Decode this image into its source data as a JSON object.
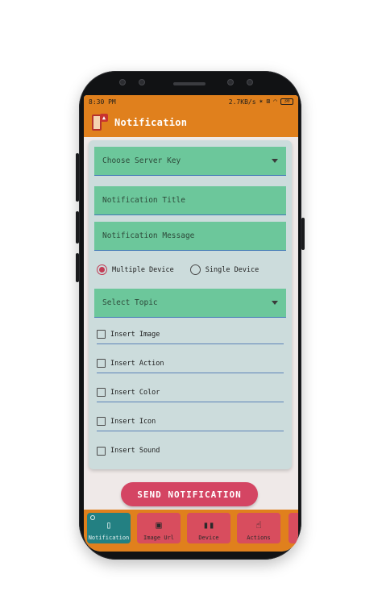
{
  "status_bar": {
    "time": "8:30 PM",
    "speed": "2.7KB/s",
    "battery": "30"
  },
  "app_bar": {
    "title": "Notification"
  },
  "form": {
    "server_key_placeholder": "Choose Server Key",
    "title_placeholder": "Notification Title",
    "message_placeholder": "Notification Message",
    "radio_options": [
      {
        "label": "Multiple Device",
        "selected": true
      },
      {
        "label": "Single Device",
        "selected": false
      }
    ],
    "topic_placeholder": "Select Topic",
    "checkboxes": [
      {
        "label": "Insert Image",
        "checked": false
      },
      {
        "label": "Insert Action",
        "checked": false
      },
      {
        "label": "Insert Color",
        "checked": false
      },
      {
        "label": "Insert Icon",
        "checked": false
      },
      {
        "label": "Insert Sound",
        "checked": false
      }
    ]
  },
  "send_button": {
    "label": "SEND NOTIFICATION"
  },
  "bottom_nav": {
    "items": [
      {
        "label": "Notification",
        "icon": "notification-icon",
        "active": true
      },
      {
        "label": "Image Url",
        "icon": "image-icon",
        "active": false
      },
      {
        "label": "Device",
        "icon": "device-icon",
        "active": false
      },
      {
        "label": "Actions",
        "icon": "hand-pointer-icon",
        "active": false
      }
    ]
  },
  "colors": {
    "app_bar": "#e0801d",
    "field": "#6cc79b",
    "card": "#ccdcdc",
    "send_button": "#d44563",
    "nav_item": "#d84d5e",
    "nav_active": "#238082"
  }
}
